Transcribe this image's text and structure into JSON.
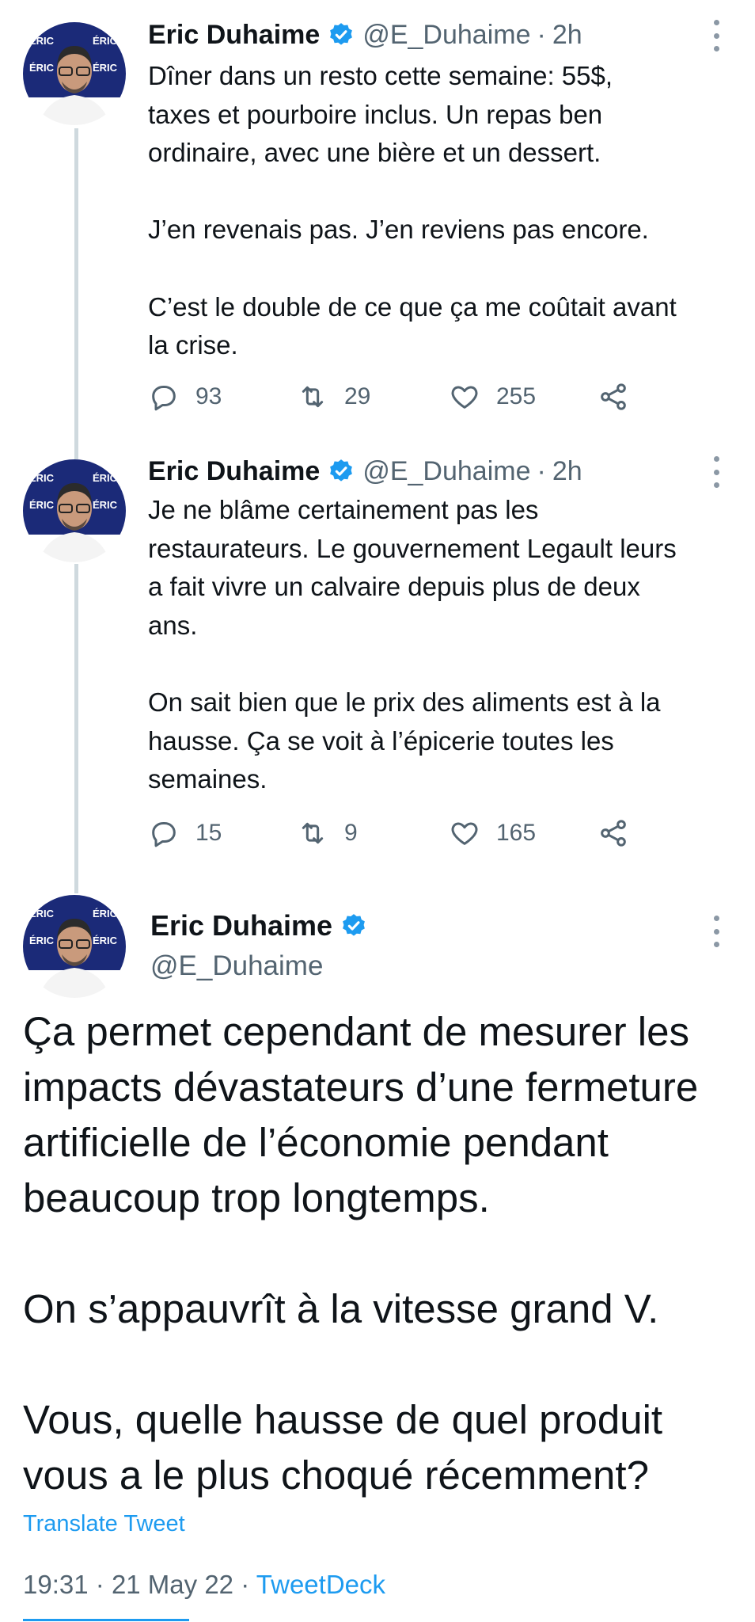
{
  "author": {
    "name": "Eric Duhaime",
    "handle": "@E_Duhaime",
    "verified": true,
    "avatar_icon": "profile-photo",
    "avatar_backdrop_text": "ÉRIC DUHAIME"
  },
  "colors": {
    "accent": "#1d9bf0",
    "text": "#0f1419",
    "secondary": "#536471",
    "thread_line": "#cfd9de"
  },
  "tweets": [
    {
      "time": "2h",
      "text": "Dîner dans un resto cette semaine: 55$,\ntaxes et pourboire inclus. Un repas ben\nordinaire, avec une bière et un dessert.\n\nJ’en revenais pas. J’en reviens pas encore.\n\nC’est le double de ce que ça me coûtait avant\nla crise.",
      "replies": "93",
      "retweets": "29",
      "likes": "255"
    },
    {
      "time": "2h",
      "text": "Je ne blâme certainement pas les\nrestaurateurs. Le gouvernement Legault leurs\na fait vivre un calvaire depuis plus de deux\nans.\n\nOn sait bien que le prix des aliments est à la\nhausse. Ça se voit à l’épicerie toutes les\nsemaines.",
      "replies": "15",
      "retweets": "9",
      "likes": "165"
    }
  ],
  "main_tweet": {
    "text": "Ça permet cependant de mesurer les\nimpacts dévastateurs d’une fermeture\nartificielle de l’économie pendant\nbeaucoup trop longtemps.\n\nOn s’appauvrît à la vitesse grand V.\n\nVous, quelle hausse de quel produit\nvous a le plus choqué récemment?",
    "translate_label": "Translate Tweet",
    "time": "19:31",
    "date": "21 May 22",
    "source": "TweetDeck"
  },
  "separator": "·"
}
